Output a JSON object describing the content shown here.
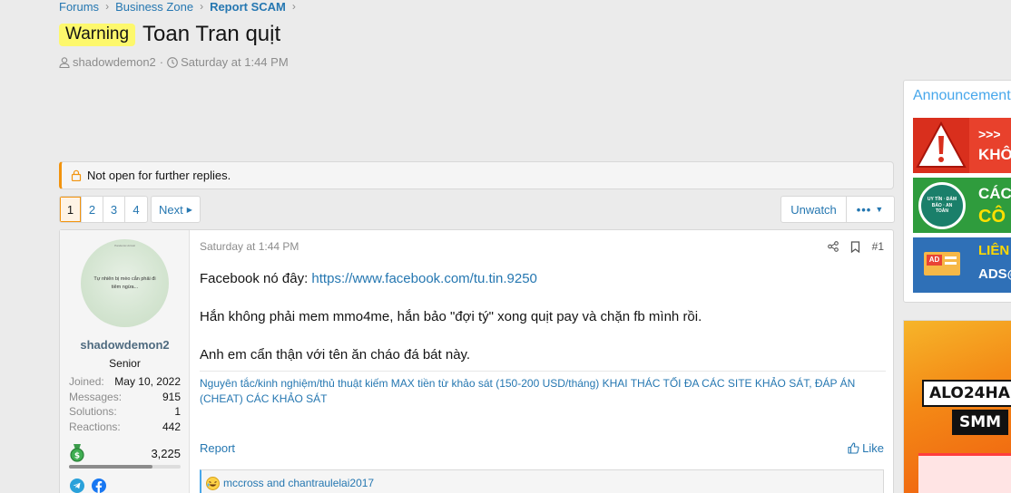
{
  "breadcrumb": {
    "items": [
      "Forums",
      "Business Zone",
      "Report SCAM"
    ]
  },
  "thread": {
    "prefix": "Warning",
    "title": "Toan Tran quịt",
    "author": "shadowdemon2",
    "date": "Saturday at 1:44 PM",
    "notice": "Not open for further replies."
  },
  "pagination": {
    "pages": [
      "1",
      "2",
      "3",
      "4"
    ],
    "current": "1",
    "next_label": "Next"
  },
  "actions": {
    "unwatch": "Unwatch",
    "more": "•••"
  },
  "user": {
    "avatar_top_text": "Pandemic Arrival",
    "avatar_text": "Tự nhiên bị mèo cắn phải đi tiêm ngừa...",
    "name": "shadowdemon2",
    "title": "Senior",
    "stats": [
      {
        "label": "Joined:",
        "value": "May 10, 2022"
      },
      {
        "label": "Messages:",
        "value": "915"
      },
      {
        "label": "Solutions:",
        "value": "1"
      },
      {
        "label": "Reactions:",
        "value": "442"
      }
    ],
    "points": "3,225",
    "points_progress": 0.75
  },
  "post": {
    "date": "Saturday at 1:44 PM",
    "number": "#1",
    "line1_prefix": "Facebook nó đây: ",
    "line1_link": "https://www.facebook.com/tu.tin.9250",
    "line2": "Hắn không phải mem mmo4me, hắn bảo \"đợi tý\" xong quịt pay và chặn fb mình rồi.",
    "line3": "Anh em cẩn thận với tên ăn cháo đá bát này.",
    "signature": "Nguyên tắc/kinh nghiệm/thủ thuật kiếm MAX tiền từ khảo sát (150-200 USD/tháng) KHAI THÁC TỐI ĐA CÁC SITE KHẢO SÁT, ĐÁP ÁN (CHEAT) CÁC KHẢO SÁT",
    "report": "Report",
    "like": "Like",
    "reactions": "mccross and chantraulelai2017"
  },
  "sidebar": {
    "title": "Announcements",
    "banner1": ">>> ",
    "banner1b": "KHÔN",
    "banner2": "CÁC",
    "banner2b": "CÔ",
    "banner3": "LIÊN",
    "banner3b": "ADS@",
    "banner2_badge": "UY TÍN · ĐẢM BẢO · AN TOÀN",
    "banner3_icon": "AD"
  },
  "ad": {
    "label1": "ALO24HA",
    "label2": "SMM"
  },
  "colors": {
    "link": "#2577b1",
    "warning_bg": "#fdf86c",
    "notice_accent": "#f2930d"
  }
}
